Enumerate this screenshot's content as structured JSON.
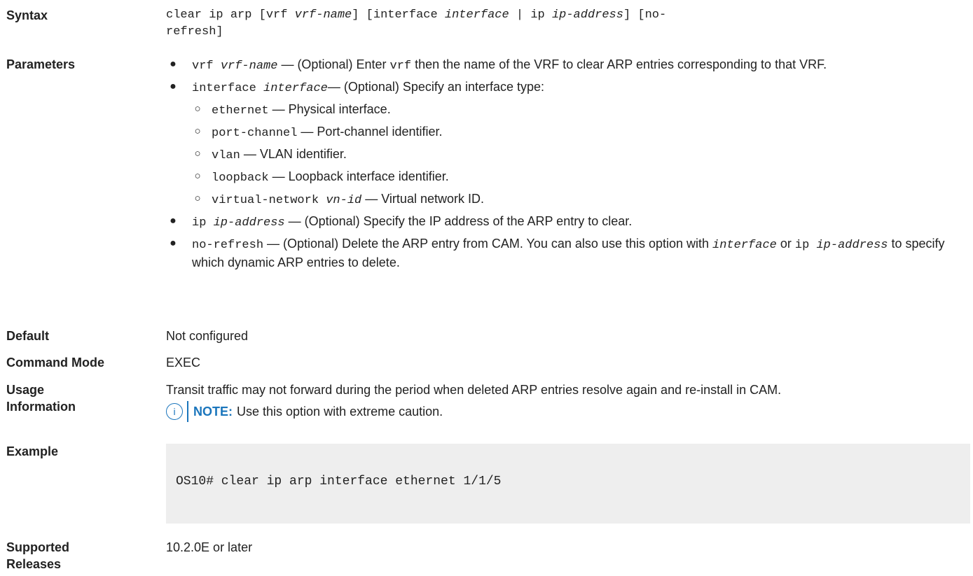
{
  "labels": {
    "syntax": "Syntax",
    "parameters": "Parameters",
    "default": "Default",
    "command_mode": "Command Mode",
    "usage_1": "Usage",
    "usage_2": "Information",
    "example": "Example",
    "supported_1": "Supported",
    "supported_2": "Releases"
  },
  "syntax": {
    "line1_a": "clear ip arp [vrf ",
    "line1_b": "vrf-name",
    "line1_c": "] [interface ",
    "line1_d": "interface",
    "line1_e": " | ip ",
    "line1_f": "ip-address",
    "line1_g": "] [no-",
    "line2": "refresh]"
  },
  "parameters": {
    "vrf": {
      "kw": "vrf ",
      "arg": "vrf-name",
      "t1": " — (Optional) Enter ",
      "kw2": "vrf",
      "t2": " then the name of the VRF to clear ARP entries corresponding to that VRF."
    },
    "interface": {
      "kw": "interface ",
      "arg": "interface",
      "t1": "— (Optional) Specify an interface type:",
      "sub": [
        {
          "kw": "ethernet",
          "text": " — Physical interface."
        },
        {
          "kw": "port-channel",
          "text": " — Port-channel identifier."
        },
        {
          "kw": "vlan",
          "text": " — VLAN identifier."
        },
        {
          "kw": "loopback",
          "text": " — Loopback interface identifier."
        },
        {
          "kw": "virtual-network ",
          "arg": "vn-id",
          "text": " — Virtual network ID."
        }
      ]
    },
    "ip": {
      "kw": "ip ",
      "arg": "ip-address",
      "t1": " — (Optional) Specify the IP address of the ARP entry to clear."
    },
    "norefresh": {
      "kw": "no-refresh",
      "t1": " — (Optional) Delete the ARP entry from CAM. You can also use this option with ",
      "arg1": "interface",
      "t2": " or ",
      "kw2": "ip ",
      "arg2": "ip-address",
      "t3": " to specify which dynamic ARP entries to delete."
    }
  },
  "default": "Not configured",
  "command_mode": "EXEC",
  "usage": {
    "text": "Transit traffic may not forward during the period when deleted ARP entries resolve again and re-install in CAM.",
    "note_label": "NOTE:",
    "note_text": "Use this option with extreme caution.",
    "note_icon": "info-icon",
    "accent": "#1a75bc"
  },
  "example": {
    "code": "OS10# clear ip arp interface ethernet 1/1/5"
  },
  "supported": "10.2.0E or later"
}
